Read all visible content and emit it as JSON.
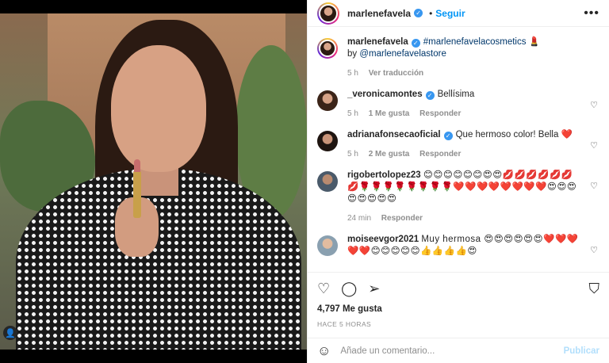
{
  "post": {
    "username": "marlenefavela",
    "follow_label": "Seguir",
    "more_label": "•••",
    "caption_user": "marlenefavela",
    "caption_hashtag": "#marlenefavelacosmetics 💄",
    "caption_by": "by",
    "caption_mention": "@marlenefavelastore",
    "caption_time": "5 h",
    "caption_translate": "Ver traducción",
    "likes": "4,797 Me gusta",
    "time_ago": "HACE 5 HORAS"
  },
  "comments": [
    {
      "user": "_veronicamontes",
      "text": "Bellísima",
      "time": "5 h",
      "likes": "1 Me gusta",
      "reply": "Responder",
      "verified": true
    },
    {
      "user": "adrianafonsecaoficial",
      "text": "Que hermoso color! Bella ❤️",
      "time": "5 h",
      "likes": "2 Me gusta",
      "reply": "Responder",
      "verified": true
    },
    {
      "user": "rigobertolopez23",
      "text": "😊😊😊😊😊😊😍😍💋💋💋💋💋💋💋🌹🌹🌹🌹🌹🌹🌹🌹❤️❤️❤️❤️❤️❤️❤️❤️😍😍😍😍😍😍😍😍",
      "time": "24 min",
      "likes": "",
      "reply": "Responder",
      "verified": false
    },
    {
      "user": "moiseevgor2021",
      "text": "Muy hermosa 😍😍😍😍😍😍❤️❤️❤️❤️❤️😊😊😊😊😊👍👍👍👍😍",
      "time": "",
      "likes": "",
      "reply": "",
      "verified": false
    }
  ],
  "add_comment": {
    "placeholder": "Añade un comentario...",
    "post_label": "Publicar"
  },
  "icons": {
    "heart": "heart-icon",
    "comment": "comment-icon",
    "share": "share-icon",
    "save": "bookmark-icon",
    "emoji": "emoji-icon"
  },
  "colors": {
    "accent": "#0095f6",
    "verified": "#3897f0",
    "muted": "#8e8e8e"
  }
}
